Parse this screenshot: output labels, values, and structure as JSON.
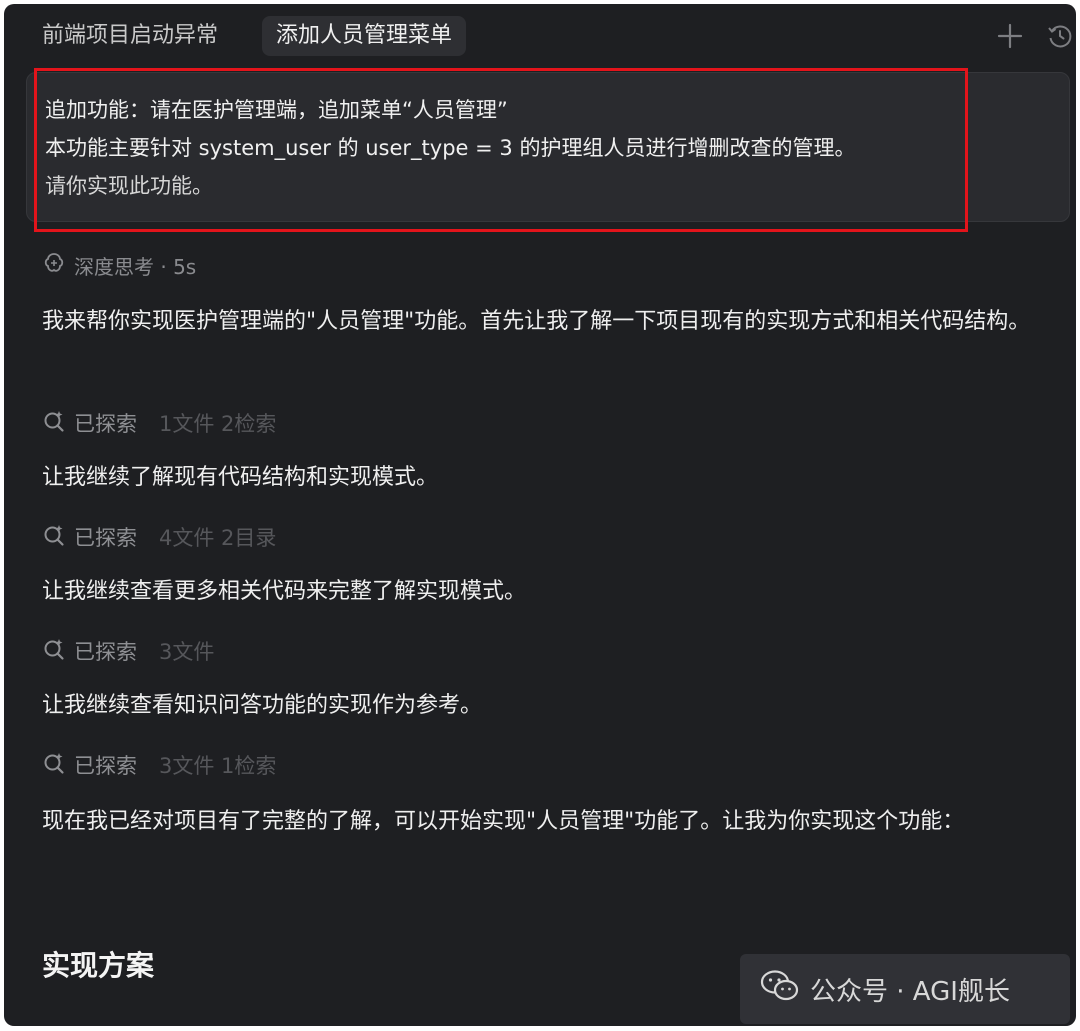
{
  "tabs": [
    {
      "label": "前端项目启动异常",
      "active": false
    },
    {
      "label": "添加人员管理菜单",
      "active": true
    }
  ],
  "header_icons": [
    "plus-icon",
    "history-icon"
  ],
  "prompt": {
    "line1": "追加功能：请在医护管理端，追加菜单“人员管理”",
    "line2": "本功能主要针对 system_user 的 user_type = 3 的护理组人员进行增删改查的管理。",
    "line3": "请你实现此功能。"
  },
  "thinking": {
    "label": "深度思考 · 5s"
  },
  "messages": [
    "我来帮你实现医护管理端的\"人员管理\"功能。首先让我了解一下项目现有的实现方式和相关代码结构。",
    "让我继续了解现有代码结构和实现模式。",
    "让我继续查看更多相关代码来完整了解实现模式。",
    "让我继续查看知识问答功能的实现作为参考。",
    "现在我已经对项目有了完整的了解，可以开始实现\"人员管理\"功能了。让我为你实现这个功能："
  ],
  "explorations": [
    {
      "label": "已探索",
      "meta": "1文件 2检索"
    },
    {
      "label": "已探索",
      "meta": "4文件 2目录"
    },
    {
      "label": "已探索",
      "meta": "3文件"
    },
    {
      "label": "已探索",
      "meta": "3文件 1检索"
    }
  ],
  "section_title": "实现方案",
  "watermark": "公众号 · AGI舰长",
  "colors": {
    "background": "#1e1f22",
    "highlight": "#e3141b",
    "muted": "#8e8f93"
  }
}
